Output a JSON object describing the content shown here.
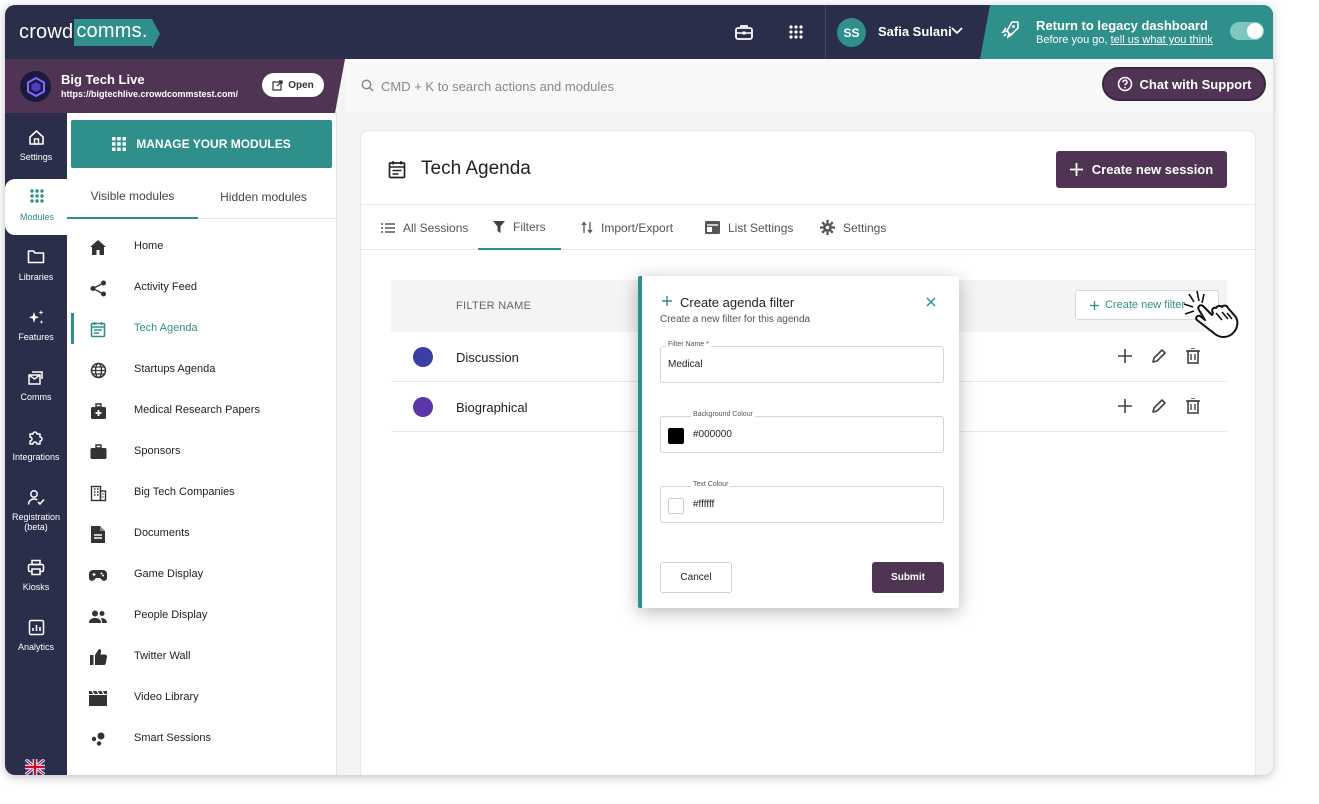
{
  "brand": {
    "part1": "crowd",
    "part2": "comms",
    "dot": "."
  },
  "user": {
    "initials": "SS",
    "name": "Safia Sulani"
  },
  "legacy": {
    "title": "Return to legacy dashboard",
    "prefix": "Before you go, ",
    "link": "tell us what you think"
  },
  "event": {
    "name": "Big Tech Live",
    "url": "https://bigtechlive.crowdcommstest.com/",
    "open_label": "Open"
  },
  "search": {
    "placeholder": "CMD + K to search actions and modules"
  },
  "support": {
    "label": "Chat with Support"
  },
  "leftnav": [
    {
      "label": "Settings",
      "icon": "home-icon"
    },
    {
      "label": "Modules",
      "icon": "grid-icon"
    },
    {
      "label": "Libraries",
      "icon": "folder-icon"
    },
    {
      "label": "Features",
      "icon": "sparkle-icon"
    },
    {
      "label": "Comms",
      "icon": "comms-icon"
    },
    {
      "label": "Integrations",
      "icon": "puzzle-icon"
    },
    {
      "label": "Registration (beta)",
      "icon": "registration-icon"
    },
    {
      "label": "Kiosks",
      "icon": "printer-icon"
    },
    {
      "label": "Analytics",
      "icon": "analytics-icon"
    }
  ],
  "modules": {
    "manage_label": "MANAGE YOUR MODULES",
    "tabs": [
      "Visible modules",
      "Hidden modules"
    ],
    "items": [
      {
        "label": "Home",
        "icon": "home-icon"
      },
      {
        "label": "Activity Feed",
        "icon": "share-icon"
      },
      {
        "label": "Tech Agenda",
        "icon": "calendar-icon"
      },
      {
        "label": "Startups Agenda",
        "icon": "globe-icon"
      },
      {
        "label": "Medical Research Papers",
        "icon": "medical-icon"
      },
      {
        "label": "Sponsors",
        "icon": "briefcase-icon"
      },
      {
        "label": "Big Tech Companies",
        "icon": "building-icon"
      },
      {
        "label": "Documents",
        "icon": "document-icon"
      },
      {
        "label": "Game Display",
        "icon": "gamepad-icon"
      },
      {
        "label": "People Display",
        "icon": "people-icon"
      },
      {
        "label": "Twitter Wall",
        "icon": "thumbs-up-icon"
      },
      {
        "label": "Video Library",
        "icon": "clapper-icon"
      },
      {
        "label": "Smart Sessions",
        "icon": "bubbles-icon"
      }
    ]
  },
  "page": {
    "title": "Tech Agenda",
    "create_session": "Create new session",
    "tabs": [
      "All Sessions",
      "Filters",
      "Import/Export",
      "List Settings",
      "Settings"
    ],
    "table_header": "FILTER NAME",
    "create_filter": "Create new filter",
    "rows": [
      {
        "name": "Discussion",
        "color": "#3a3fa3"
      },
      {
        "name": "Biographical",
        "color": "#5b36a8"
      }
    ]
  },
  "modal": {
    "title": "Create agenda filter",
    "subtitle": "Create a new filter for this agenda",
    "filter_name_label": "Filter Name *",
    "filter_name_value": "Medical",
    "bg_label": "Background Colour",
    "bg_value": "#000000",
    "text_label": "Text Colour",
    "text_value": "#ffffff",
    "cancel": "Cancel",
    "submit": "Submit"
  },
  "colors": {
    "navy": "#2b2e4a",
    "teal": "#2f8f8a",
    "plum": "#4f3553"
  }
}
